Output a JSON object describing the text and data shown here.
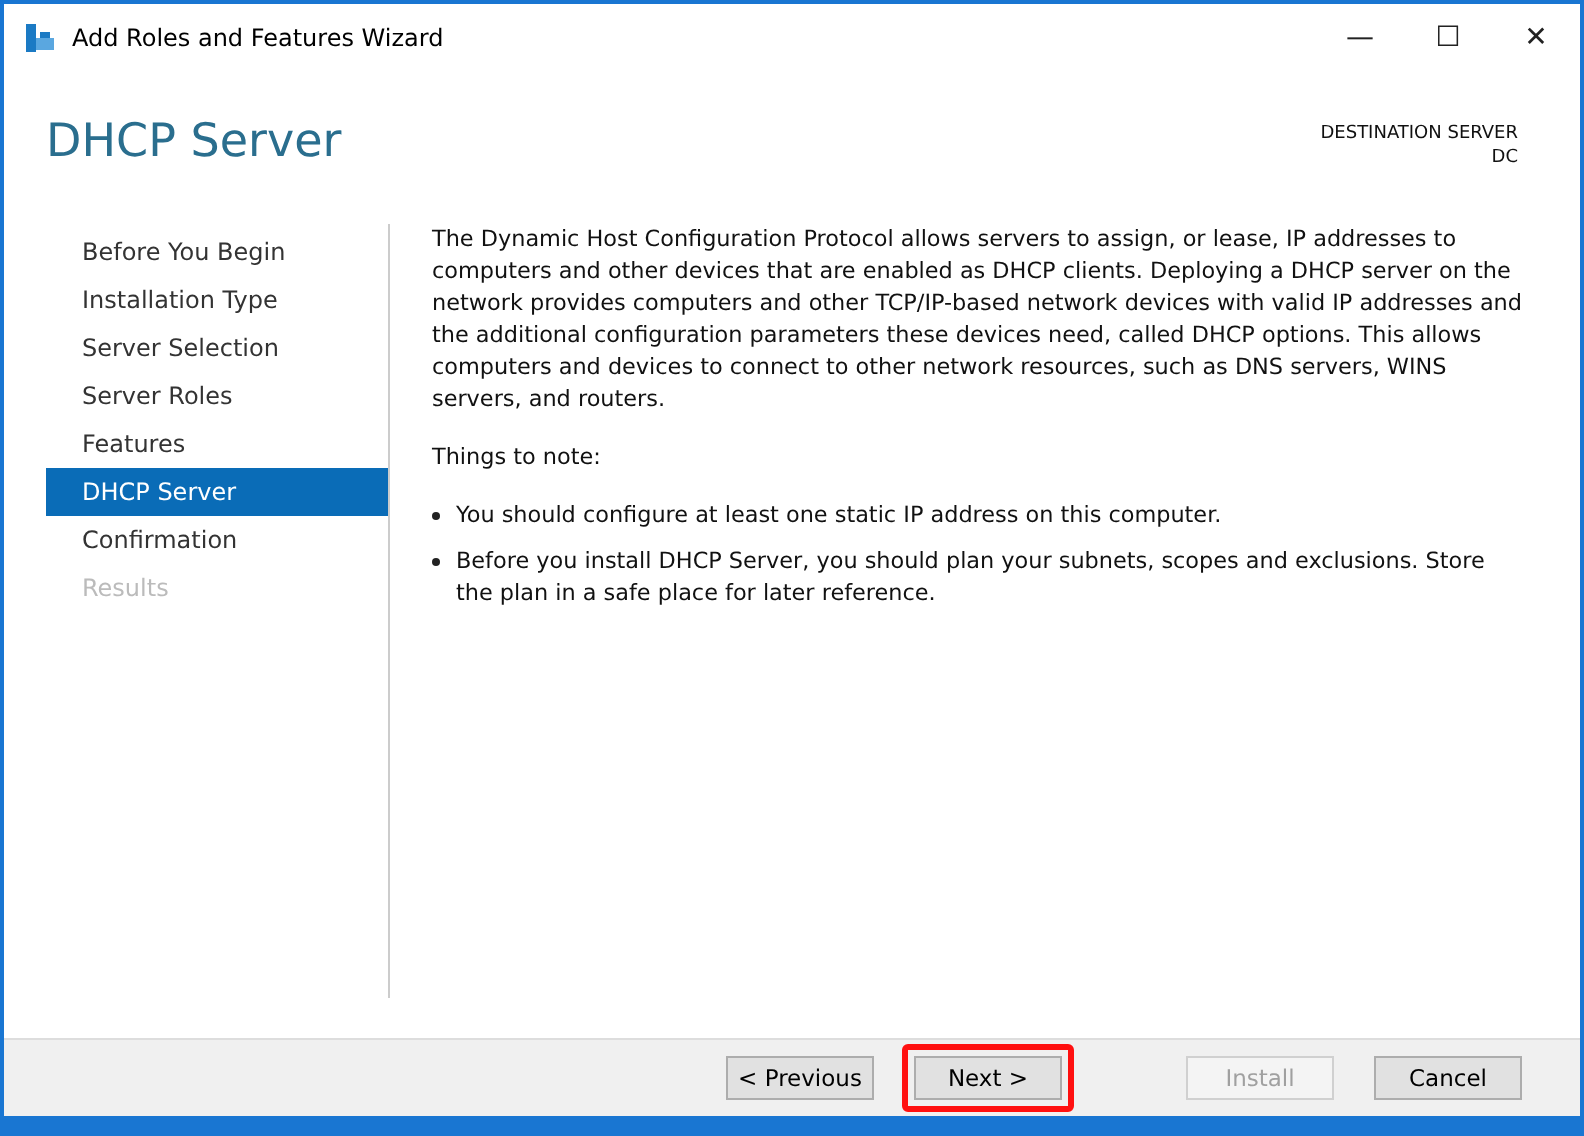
{
  "window": {
    "title": "Add Roles and Features Wizard",
    "controls": [
      "—",
      "☐",
      "✕"
    ]
  },
  "header": {
    "title": "DHCP Server",
    "destination_label": "DESTINATION SERVER",
    "destination_value": "DC"
  },
  "sidebar": {
    "items": [
      {
        "label": "Before You Begin",
        "selected": false,
        "disabled": false
      },
      {
        "label": "Installation Type",
        "selected": false,
        "disabled": false
      },
      {
        "label": "Server Selection",
        "selected": false,
        "disabled": false
      },
      {
        "label": "Server Roles",
        "selected": false,
        "disabled": false
      },
      {
        "label": "Features",
        "selected": false,
        "disabled": false
      },
      {
        "label": "DHCP Server",
        "selected": true,
        "disabled": false
      },
      {
        "label": "Confirmation",
        "selected": false,
        "disabled": false
      },
      {
        "label": "Results",
        "selected": false,
        "disabled": true
      }
    ]
  },
  "content": {
    "description": "The Dynamic Host Configuration Protocol allows servers to assign, or lease, IP addresses to computers and other devices that are enabled as DHCP clients. Deploying a DHCP server on the network provides computers and other TCP/IP-based network devices with valid IP addresses and the additional configuration parameters these devices need, called DHCP options. This allows computers and devices to connect to other network resources, such as DNS servers, WINS servers, and routers.",
    "notes_heading": "Things to note:",
    "notes": [
      "You should configure at least one static IP address on this computer.",
      "Before you install DHCP Server, you should plan your subnets, scopes and exclusions. Store the plan in a safe place for later reference."
    ]
  },
  "buttons": [
    {
      "label": "< Previous",
      "disabled": false,
      "highlighted": false
    },
    {
      "label": "Next >",
      "disabled": false,
      "highlighted": true
    },
    {
      "label": "Install",
      "disabled": true,
      "highlighted": false
    },
    {
      "label": "Cancel",
      "disabled": false,
      "highlighted": false
    }
  ]
}
